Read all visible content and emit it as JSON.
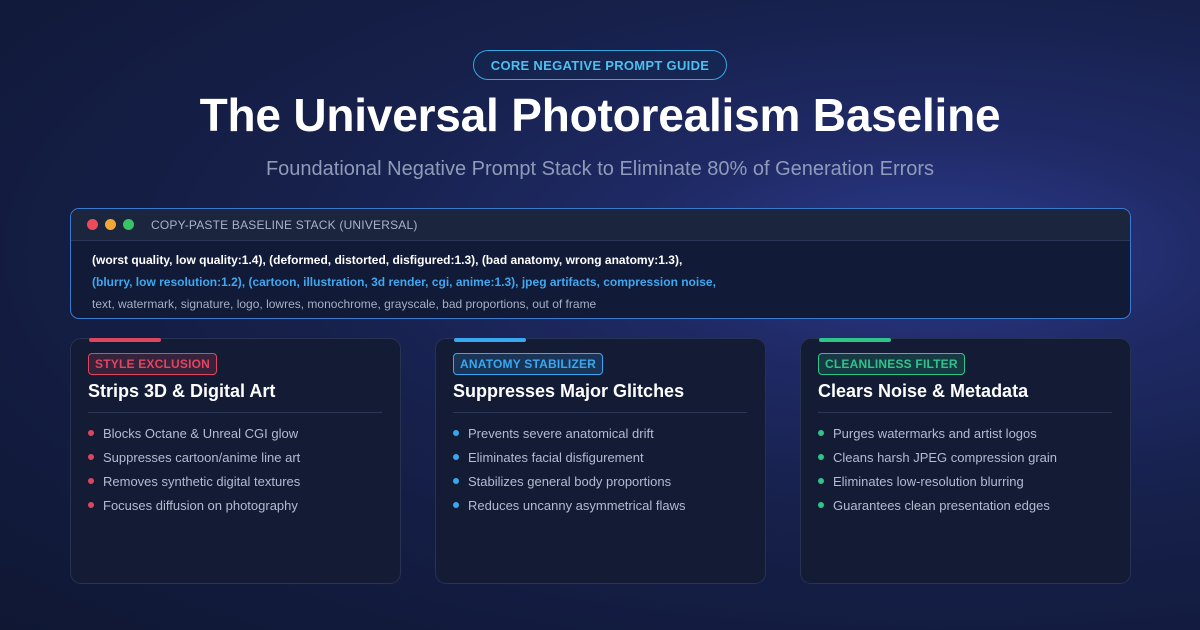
{
  "header": {
    "tag": "CORE NEGATIVE PROMPT GUIDE",
    "title": "The Universal Photorealism Baseline",
    "subtitle": "Foundational Negative Prompt Stack to Eliminate 80% of Generation Errors"
  },
  "terminal": {
    "title": "COPY-PASTE BASELINE STACK (UNIVERSAL)",
    "lines": [
      "(worst quality, low quality:1.4), (deformed, distorted, disfigured:1.3), (bad anatomy, wrong anatomy:1.3),",
      "(blurry, low resolution:1.2), (cartoon, illustration, 3d render, cgi, anime:1.3), jpeg artifacts, compression noise,",
      "text, watermark, signature, logo, lowres, monochrome, grayscale, bad proportions, out of frame"
    ],
    "dot_colors": [
      "#ee4b5a",
      "#f2a633",
      "#37c463"
    ]
  },
  "cards": [
    {
      "badge": "STYLE EXCLUSION",
      "title": "Strips 3D & Digital Art",
      "color": "#e0455f",
      "items": [
        "Blocks Octane & Unreal CGI glow",
        "Suppresses cartoon/anime line art",
        "Removes synthetic digital textures",
        "Focuses diffusion on photography"
      ]
    },
    {
      "badge": "ANATOMY STABILIZER",
      "title": "Suppresses Major Glitches",
      "color": "#3aa8f0",
      "items": [
        "Prevents severe anatomical drift",
        "Eliminates facial disfigurement",
        "Stabilizes general body proportions",
        "Reduces uncanny asymmetrical flaws"
      ]
    },
    {
      "badge": "CLEANLINESS FILTER",
      "title": "Clears Noise & Metadata",
      "color": "#2fc489",
      "items": [
        "Purges watermarks and artist logos",
        "Cleans harsh JPEG compression grain",
        "Eliminates low-resolution blurring",
        "Guarantees clean presentation edges"
      ]
    }
  ]
}
